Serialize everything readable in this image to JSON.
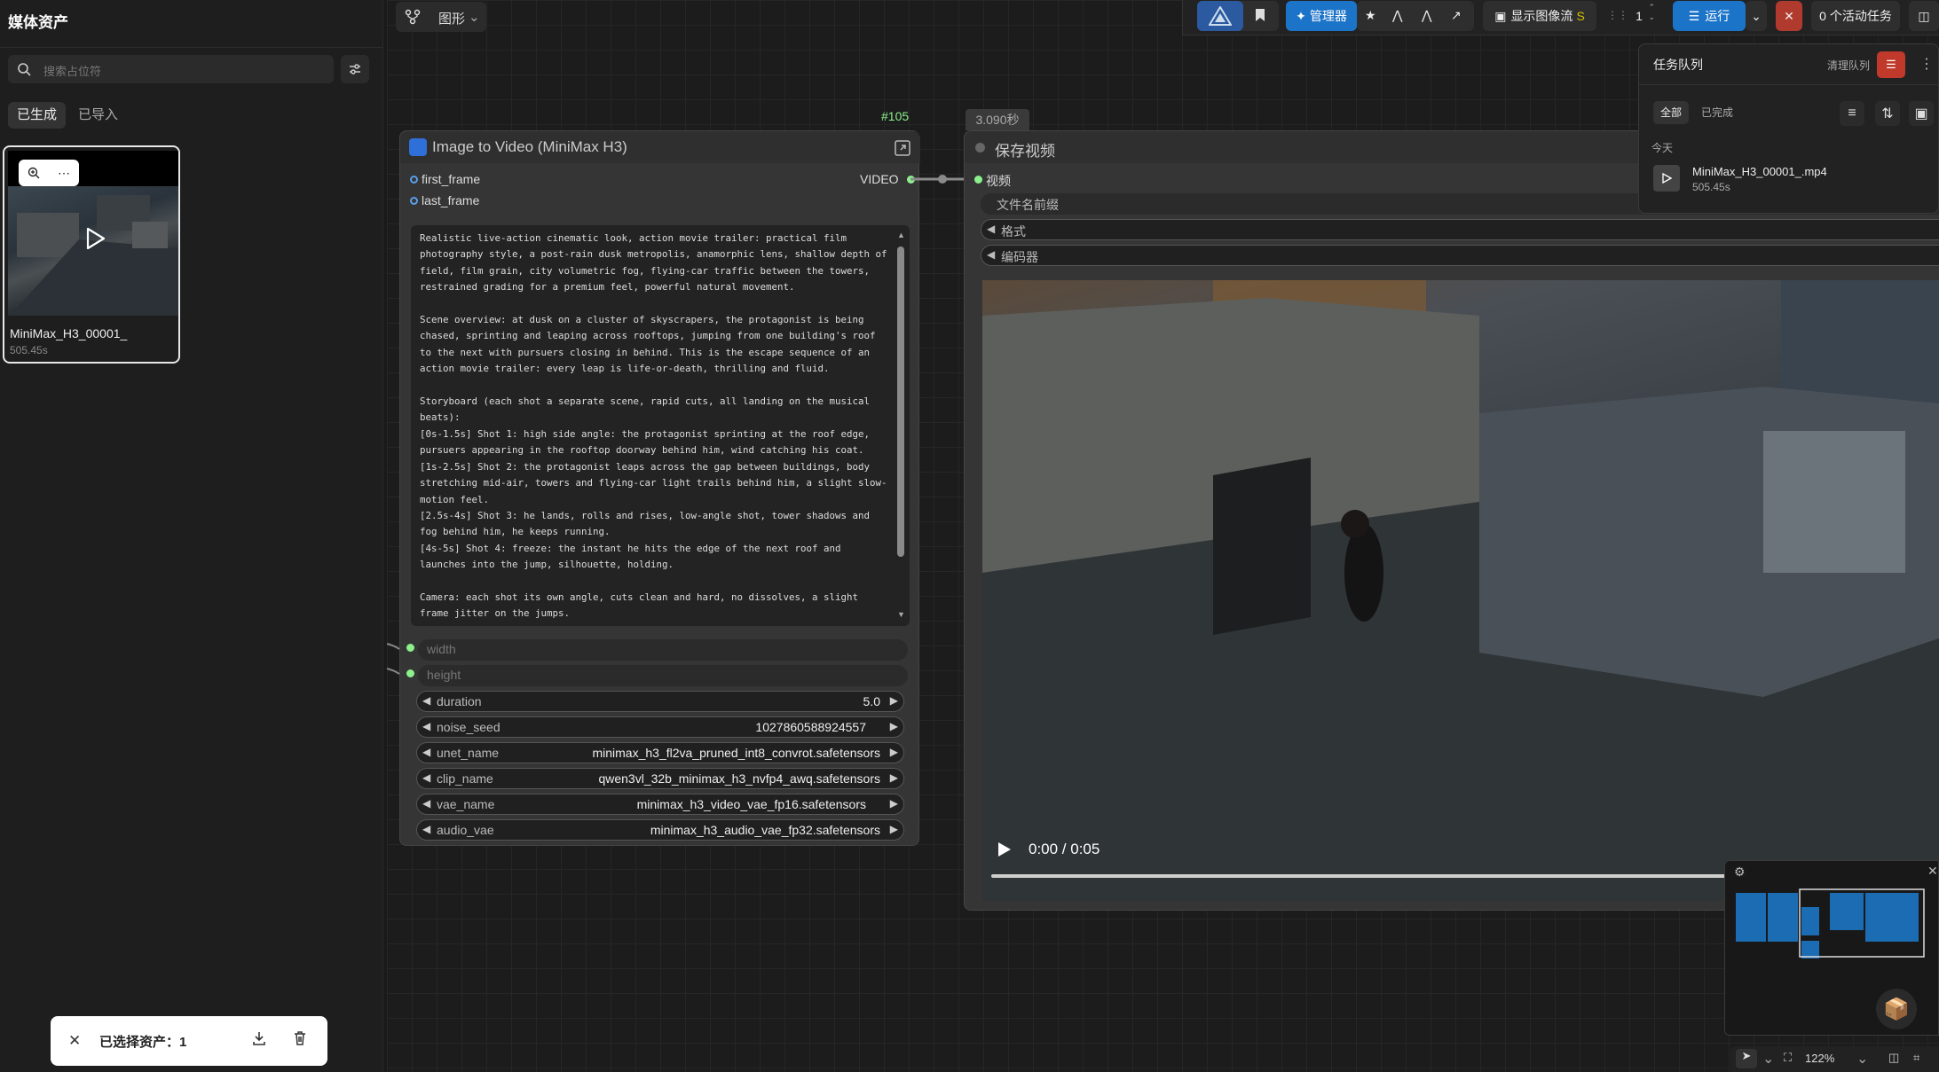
{
  "sidebar": {
    "title": "媒体资产",
    "search_placeholder": "搜索占位符",
    "tabs": [
      {
        "label": "已生成"
      },
      {
        "label": "已导入"
      }
    ],
    "asset": {
      "name": "MiniMax_H3_00001_",
      "duration": "505.45s"
    },
    "selection": {
      "label": "已选择资产：1"
    }
  },
  "toolbar": {
    "graph_label": "图形",
    "manager_label": "管理器",
    "image_flow_label": "显示图像流",
    "batch_count": "1",
    "run_label": "运行",
    "active_tasks": "0 个活动任务"
  },
  "node": {
    "id": "#105",
    "title": "Image to Video (MiniMax H3)",
    "inputs": [
      "first_frame",
      "last_frame"
    ],
    "output": "VIDEO",
    "prompt": "Realistic live-action cinematic look, action movie trailer: practical film photography style, a post-rain dusk metropolis, anamorphic lens, shallow depth of field, film grain, city volumetric fog, flying-car traffic between the towers, restrained grading for a premium feel, powerful natural movement.\n\nScene overview: at dusk on a cluster of skyscrapers, the protagonist is being chased, sprinting and leaping across rooftops, jumping from one building's roof to the next with pursuers closing in behind. This is the escape sequence of an action movie trailer: every leap is life-or-death, thrilling and fluid.\n\nStoryboard (each shot a separate scene, rapid cuts, all landing on the musical beats):\n[0s-1.5s] Shot 1: high side angle: the protagonist sprinting at the roof edge, pursuers appearing in the rooftop doorway behind him, wind catching his coat.\n[1s-2.5s] Shot 2: the protagonist leaps across the gap between buildings, body stretching mid-air, towers and flying-car light trails behind him, a slight slow-motion feel.\n[2.5s-4s] Shot 3: he lands, rolls and rises, low-angle shot, tower shadows and fog behind him, he keeps running.\n[4s-5s] Shot 4: freeze: the instant he hits the edge of the next roof and launches into the jump, silhouette, holding.\n\nCamera: each shot its own angle, cuts clean and hard, no dissolves, a slight frame jitter on the jumps.\n\nAudio: wind, rapid footsteps, city ambience, low score underneath, an accent hit on each",
    "converted_inputs": [
      "width",
      "height"
    ],
    "widgets": [
      {
        "name": "duration",
        "value": "5.0"
      },
      {
        "name": "noise_seed",
        "value": "1027860588924557"
      },
      {
        "name": "unet_name",
        "value": "minimax_h3_fl2va_pruned_int8_convrot.safetensors"
      },
      {
        "name": "clip_name",
        "value": "qwen3vl_32b_minimax_h3_nvfp4_awq.safetensors"
      },
      {
        "name": "vae_name",
        "value": "minimax_h3_video_vae_fp16.safetensors"
      },
      {
        "name": "audio_vae",
        "value": "minimax_h3_audio_vae_fp32.safetensors"
      }
    ]
  },
  "save_node": {
    "time": "3.090秒",
    "title": "保存视频",
    "input": "视频",
    "rows": [
      "文件名前缀",
      "格式",
      "编码器"
    ],
    "video_time": "0:00 / 0:05"
  },
  "queue": {
    "title": "任务队列",
    "clear_label": "清理队列",
    "tabs": [
      "全部",
      "已完成"
    ],
    "group": "今天",
    "item": {
      "name": "MiniMax_H3_00001_.mp4",
      "duration": "505.45s"
    }
  },
  "zoom": "122%",
  "colors": {
    "accent": "#1c74c9",
    "danger": "#c0392b",
    "connected": "#8cf08c",
    "input_dot": "#5aa0e8"
  }
}
